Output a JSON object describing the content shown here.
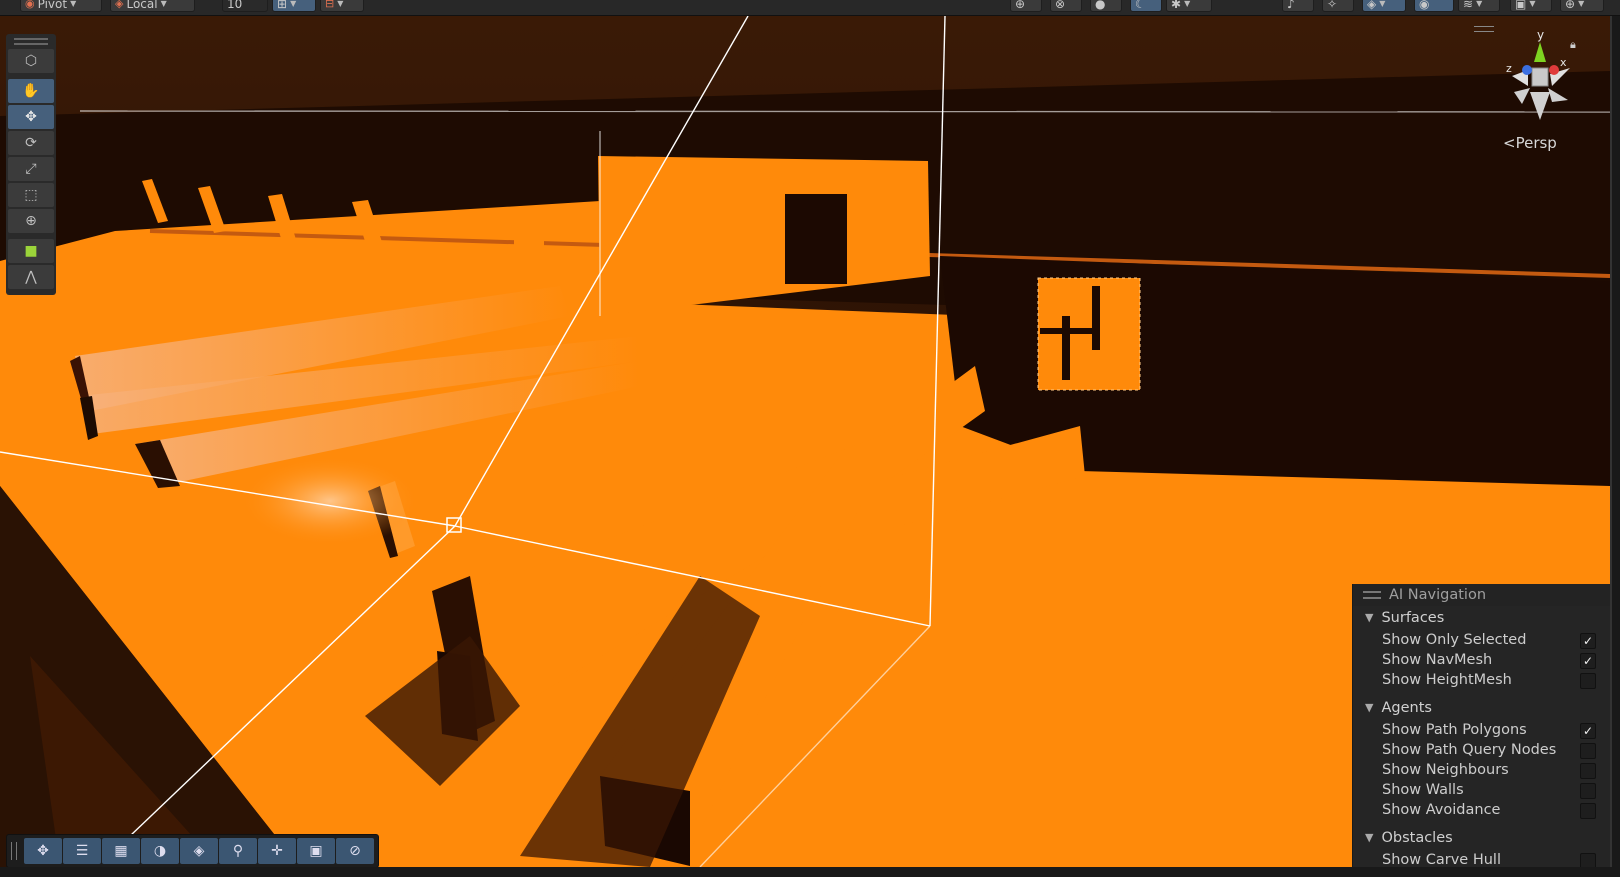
{
  "toolbar": {
    "pivot_label": "Pivot",
    "local_label": "Local",
    "snap_value": "10",
    "icons": [
      "pivot-icon",
      "local-icon",
      "grid-snap-icon",
      "increment-snap-icon",
      "globe-icon",
      "shading-icon",
      "sphere-icon",
      "moon-icon",
      "bug-icon",
      "audio-icon",
      "effects-icon",
      "layers-icon",
      "visibility-icon",
      "stack-icon",
      "camera-icon",
      "gizmos-icon"
    ]
  },
  "tools": [
    {
      "name": "view-cube-icon",
      "glyph": "⬡"
    },
    {
      "name": "hand-icon",
      "glyph": "✋"
    },
    {
      "name": "move-icon",
      "glyph": "✥"
    },
    {
      "name": "rotate-icon",
      "glyph": "⟳"
    },
    {
      "name": "scale-icon",
      "glyph": "⤢"
    },
    {
      "name": "rect-icon",
      "glyph": "⬚"
    },
    {
      "name": "transform-icon",
      "glyph": "⊕"
    },
    {
      "name": "custom-cube-icon",
      "glyph": "■"
    },
    {
      "name": "navmesh-edit-icon",
      "glyph": "⋀"
    }
  ],
  "viewport": {
    "camera_label": "Persp",
    "gizmo_axes": {
      "y": "y",
      "x": "x",
      "z": "z"
    }
  },
  "bottom_toolbar": {
    "icons": [
      "move-icon",
      "tools-settings-icon",
      "grid-icon",
      "shading-icon",
      "layers-icon",
      "search-icon",
      "pivot-icon",
      "camera-icon",
      "compass-icon"
    ],
    "glyphs": [
      "✥",
      "☰",
      "▦",
      "◑",
      "◈",
      "⚲",
      "✛",
      "▣",
      "⊘"
    ]
  },
  "ai_navigation": {
    "title": "AI Navigation",
    "sections": [
      {
        "label": "Surfaces",
        "options": [
          {
            "label": "Show Only Selected",
            "checked": true
          },
          {
            "label": "Show NavMesh",
            "checked": true
          },
          {
            "label": "Show HeightMesh",
            "checked": false
          }
        ]
      },
      {
        "label": "Agents",
        "options": [
          {
            "label": "Show Path Polygons",
            "checked": true
          },
          {
            "label": "Show Path Query Nodes",
            "checked": false
          },
          {
            "label": "Show Neighbours",
            "checked": false
          },
          {
            "label": "Show Walls",
            "checked": false
          },
          {
            "label": "Show Avoidance",
            "checked": false
          }
        ]
      },
      {
        "label": "Obstacles",
        "options": [
          {
            "label": "Show Carve Hull",
            "checked": false
          }
        ]
      }
    ]
  },
  "colors": {
    "accent": "#46607c",
    "floor": "#ff8a0a",
    "shadow": "#2a1204",
    "background": "#1a0b02"
  }
}
